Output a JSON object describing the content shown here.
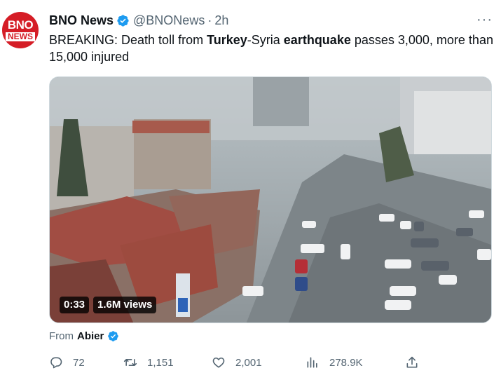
{
  "tweet": {
    "author_name": "BNO News",
    "avatar_line1": "BNO",
    "avatar_line2": "NEWS",
    "handle": "@BNONews",
    "separator": "·",
    "time": "2h",
    "text_prefix": "BREAKING: Death toll from ",
    "text_bold1": "Turkey",
    "text_mid": "-Syria ",
    "text_bold2": "earthquake",
    "text_suffix": " passes 3,000, more than 15,000 injured",
    "more_label": "···"
  },
  "media": {
    "duration": "0:33",
    "views": "1.6M views"
  },
  "source": {
    "from_label": "From",
    "name": "Abier"
  },
  "actions": {
    "replies": "72",
    "retweets": "1,151",
    "likes": "2,001",
    "views": "278.9K"
  },
  "colors": {
    "verified": "#1d9bf0",
    "brand_red": "#d51d26",
    "muted": "#536471"
  },
  "icons": [
    "bno-news-avatar",
    "verified-icon",
    "more-icon",
    "reply-icon",
    "retweet-icon",
    "like-icon",
    "views-icon",
    "share-icon"
  ]
}
